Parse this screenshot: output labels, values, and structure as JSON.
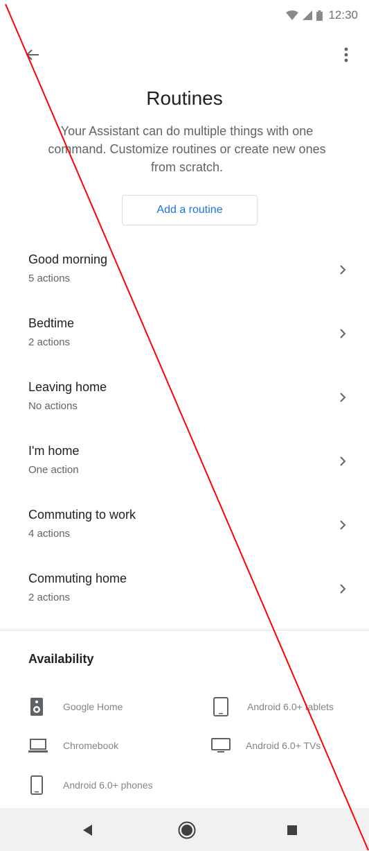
{
  "status_bar": {
    "time": "12:30"
  },
  "header": {
    "title": "Routines",
    "description": "Your Assistant can do multiple things with one command. Customize routines or create new ones from scratch.",
    "add_label": "Add a routine"
  },
  "routines": [
    {
      "name": "Good morning",
      "subtitle": "5 actions"
    },
    {
      "name": "Bedtime",
      "subtitle": "2 actions"
    },
    {
      "name": "Leaving home",
      "subtitle": "No actions"
    },
    {
      "name": "I'm home",
      "subtitle": "One action"
    },
    {
      "name": "Commuting to work",
      "subtitle": "4 actions"
    },
    {
      "name": "Commuting home",
      "subtitle": "2 actions"
    }
  ],
  "availability": {
    "title": "Availability",
    "devices": [
      {
        "label": "Google Home",
        "icon": "speaker-icon"
      },
      {
        "label": "Android 6.0+ tablets",
        "icon": "tablet-icon"
      },
      {
        "label": "Chromebook",
        "icon": "laptop-icon"
      },
      {
        "label": "Android 6.0+ TVs",
        "icon": "tv-icon"
      },
      {
        "label": "Android 6.0+ phones",
        "icon": "phone-icon"
      }
    ]
  },
  "colors": {
    "accent": "#1a73e8",
    "overlay_line": "#ff0000"
  }
}
